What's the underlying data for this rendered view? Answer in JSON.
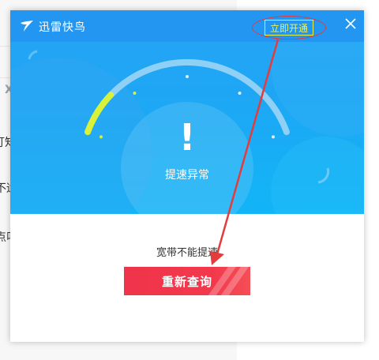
{
  "app": {
    "title": "迅雷快鸟",
    "open_button": "立即开通"
  },
  "gauge": {
    "status_label": "提速异常",
    "warning_glyph": "!",
    "level": 0.17
  },
  "main": {
    "message": "宽带不能提速",
    "retry_button": "重新查询"
  },
  "background_window": {
    "fragments": [
      "X",
      "订知",
      "不适",
      "点叫"
    ]
  },
  "colors": {
    "header_blue": "#1ea6f4",
    "titlebar_blue": "#2296f0",
    "gauge_active": "#d8f23a",
    "button_red": "#f2394c",
    "annotation_red": "#e43c3c",
    "open_button_yellow": "#e8f14a"
  },
  "icons": [
    "bird-logo-icon",
    "close-icon",
    "warning-icon"
  ]
}
